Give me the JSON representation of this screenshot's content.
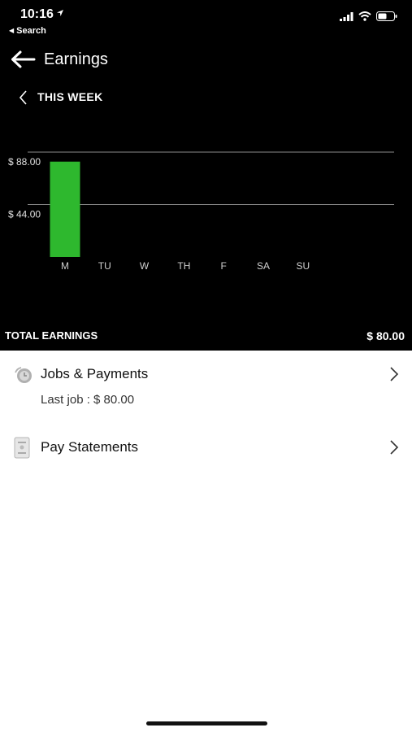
{
  "status_bar": {
    "time": "10:16",
    "back_app": "Search"
  },
  "nav": {
    "title": "Earnings",
    "period": "THIS WEEK"
  },
  "chart_data": {
    "type": "bar",
    "categories": [
      "M",
      "TU",
      "W",
      "TH",
      "F",
      "SA",
      "SU"
    ],
    "values": [
      80,
      0,
      0,
      0,
      0,
      0,
      0
    ],
    "gridlines": [
      {
        "value": 88,
        "label": "$ 88.00"
      },
      {
        "value": 44,
        "label": "$ 44.00"
      }
    ],
    "ylim": [
      0,
      88
    ],
    "bar_color": "#2eb82e",
    "grid": true
  },
  "summary": {
    "total_label": "TOTAL EARNINGS",
    "total_value": "$ 80.00"
  },
  "list": {
    "jobs_title": "Jobs & Payments",
    "jobs_sub": "Last job : $ 80.00",
    "statements_title": "Pay Statements"
  },
  "colors": {
    "background_dark": "#000000",
    "background_light": "#ffffff",
    "bar": "#2eb82e"
  }
}
